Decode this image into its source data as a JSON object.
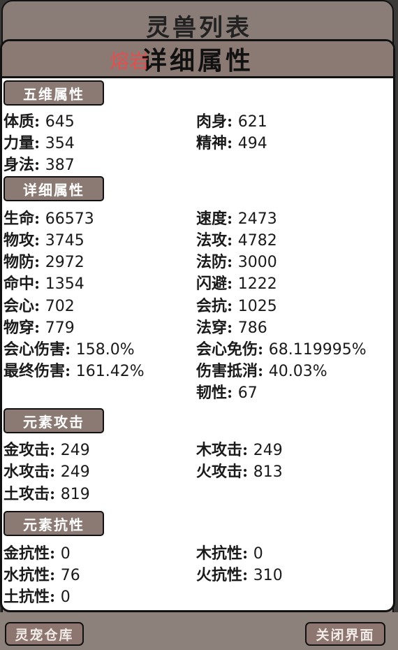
{
  "background_panel": {
    "title": "灵兽列表"
  },
  "popup": {
    "title": "详细属性",
    "variant": "熔岩",
    "sections": {
      "basic": "五维属性",
      "detail": "详细属性",
      "element_attack": "元素攻击",
      "element_resist": "元素抗性"
    },
    "basic": [
      {
        "label": "体质",
        "value": "645"
      },
      {
        "label": "肉身",
        "value": "621"
      },
      {
        "label": "力量",
        "value": "354"
      },
      {
        "label": "精神",
        "value": "494"
      },
      {
        "label": "身法",
        "value": "387"
      }
    ],
    "detail": [
      {
        "label": "生命",
        "value": "66573"
      },
      {
        "label": "速度",
        "value": "2473"
      },
      {
        "label": "物攻",
        "value": "3745"
      },
      {
        "label": "法攻",
        "value": "4782"
      },
      {
        "label": "物防",
        "value": "2972"
      },
      {
        "label": "法防",
        "value": "3000"
      },
      {
        "label": "命中",
        "value": "1354"
      },
      {
        "label": "闪避",
        "value": "1222"
      },
      {
        "label": "会心",
        "value": "702"
      },
      {
        "label": "会抗",
        "value": "1025"
      },
      {
        "label": "物穿",
        "value": "779"
      },
      {
        "label": "法穿",
        "value": "786"
      },
      {
        "label": "会心伤害",
        "value": "158.0%"
      },
      {
        "label": "会心免伤",
        "value": "68.119995%"
      },
      {
        "label": "最终伤害",
        "value": "161.42%"
      },
      {
        "label": "伤害抵消",
        "value": "40.03%"
      },
      {
        "label": "韧性",
        "value": "67"
      }
    ],
    "element_attack": [
      {
        "label": "金攻击",
        "value": "249"
      },
      {
        "label": "木攻击",
        "value": "249"
      },
      {
        "label": "水攻击",
        "value": "249"
      },
      {
        "label": "火攻击",
        "value": "813"
      },
      {
        "label": "土攻击",
        "value": "819"
      }
    ],
    "element_resist": [
      {
        "label": "金抗性",
        "value": "0"
      },
      {
        "label": "木抗性",
        "value": "0"
      },
      {
        "label": "水抗性",
        "value": "76"
      },
      {
        "label": "火抗性",
        "value": "310"
      },
      {
        "label": "土抗性",
        "value": "0"
      }
    ]
  },
  "bottom": {
    "left_button": "灵宠仓库",
    "right_button": "关闭界面"
  },
  "colors": {
    "accent": "#8b7a74",
    "variant": "#e05050"
  }
}
